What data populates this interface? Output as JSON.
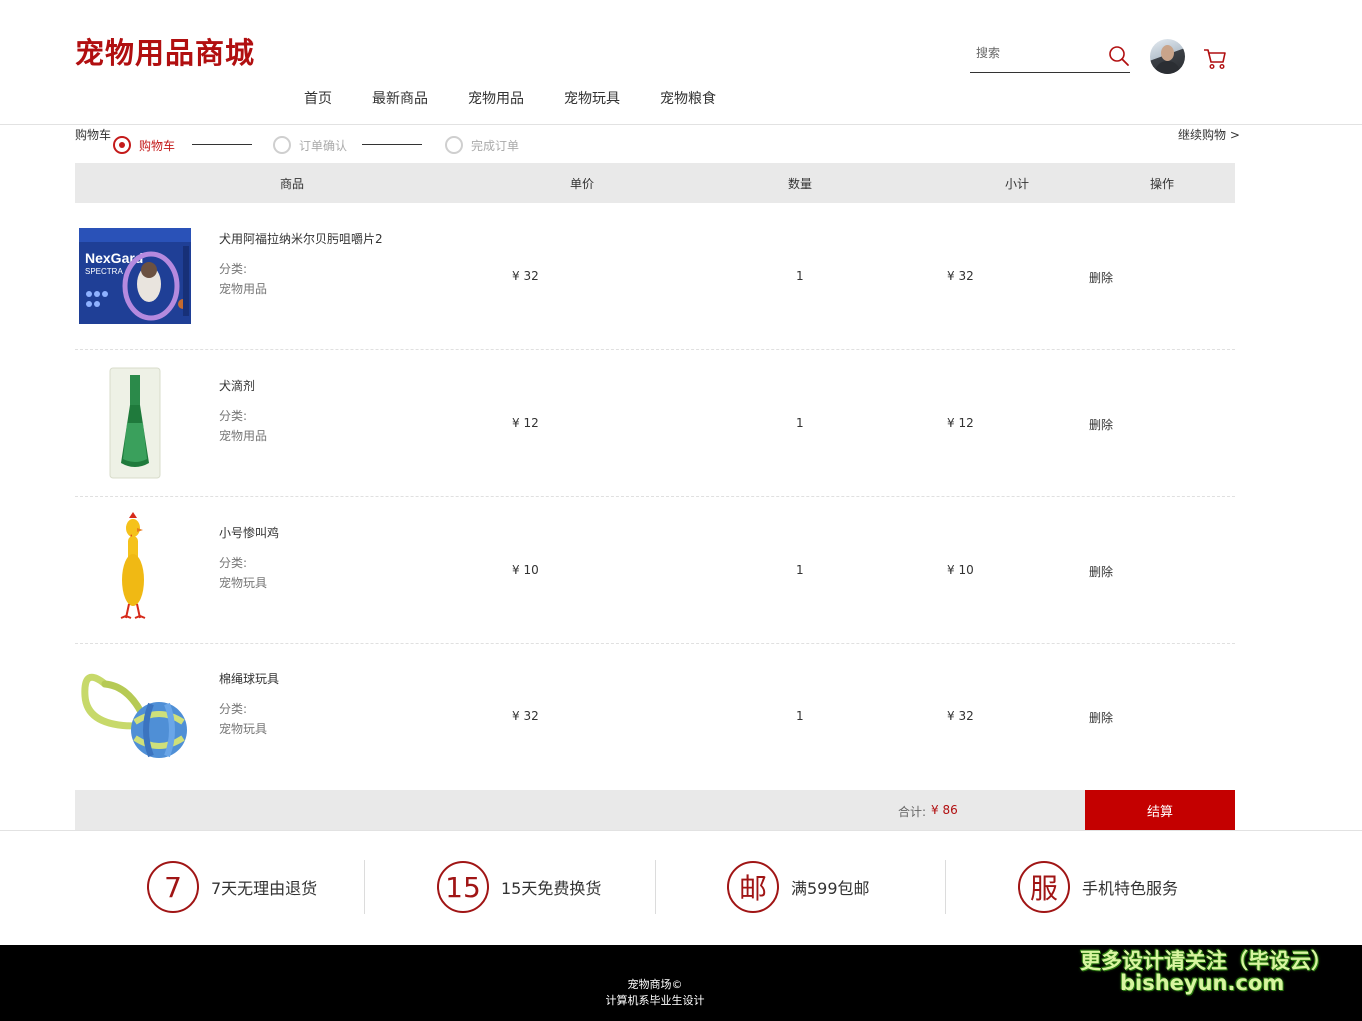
{
  "header": {
    "logo": "宠物用品商城",
    "search_placeholder": "搜索"
  },
  "nav": {
    "items": [
      "首页",
      "最新商品",
      "宠物用品",
      "宠物玩具",
      "宠物粮食"
    ]
  },
  "breadcrumb": "购物车",
  "steps": [
    "购物车",
    "订单确认",
    "完成订单"
  ],
  "active_step": 0,
  "continue_shopping": "继续购物 >",
  "table": {
    "headers": [
      "商品",
      "单价",
      "数量",
      "小计",
      "操作"
    ],
    "category_label": "分类:",
    "rows": [
      {
        "name": "犬用阿福拉纳米尔贝肟咀嚼片2",
        "category": "宠物用品",
        "price": "¥ 32",
        "qty": "1",
        "subtotal": "¥ 32",
        "action": "删除",
        "image": "nexgard-box"
      },
      {
        "name": "犬滴剂",
        "category": "宠物用品",
        "price": "¥ 12",
        "qty": "1",
        "subtotal": "¥ 12",
        "action": "删除",
        "image": "drops-pipette"
      },
      {
        "name": "小号惨叫鸡",
        "category": "宠物玩具",
        "price": "¥ 10",
        "qty": "1",
        "subtotal": "¥ 10",
        "action": "删除",
        "image": "rubber-chicken"
      },
      {
        "name": "棉绳球玩具",
        "category": "宠物玩具",
        "price": "¥ 32",
        "qty": "1",
        "subtotal": "¥ 32",
        "action": "删除",
        "image": "rope-ball"
      }
    ]
  },
  "summary": {
    "total_label": "合计:",
    "total_value": "¥ 86",
    "checkout_label": "结算"
  },
  "services": [
    {
      "badge": "7",
      "text": "7天无理由退货"
    },
    {
      "badge": "15",
      "text": "15天免费换货"
    },
    {
      "badge": "邮",
      "text": "满599包邮"
    },
    {
      "badge": "服",
      "text": "手机特色服务"
    }
  ],
  "footer": {
    "line1": "宠物商场©",
    "line2": "计算机系毕业生设计"
  },
  "watermark": {
    "line1": "更多设计请关注（毕设云）",
    "line2": "bisheyun.com"
  },
  "colors": {
    "brand": "#b10f10",
    "checkout": "#c40000",
    "footer_bg": "#000000"
  }
}
